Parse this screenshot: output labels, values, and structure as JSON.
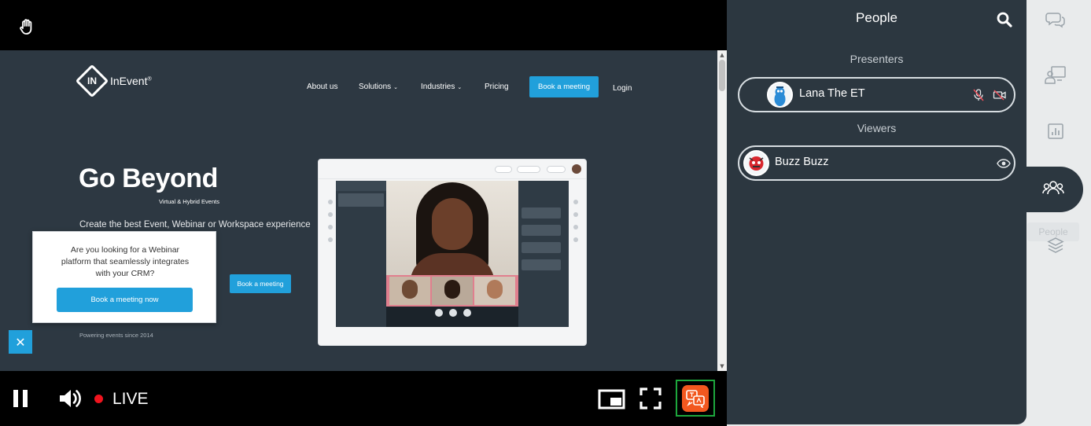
{
  "stream": {
    "site": {
      "logo_text": "InEvent",
      "logo_mark": "IN",
      "nav": [
        "About us",
        "Solutions",
        "Industries",
        "Pricing"
      ],
      "nav_book": "Book a meeting",
      "nav_login": "Login",
      "hero_title": "Go Beyond",
      "hero_subtitle": "Virtual & Hybrid Events",
      "hero_desc": "Create the best Event, Webinar or Workspace experience",
      "hero_book": "Book a meeting",
      "powered_since": "Powering events since 2014",
      "popup": {
        "text": "Are you looking for a Webinar\nplatform that seamlessly integrates\nwith your CRM?",
        "button": "Book a meeting now",
        "close": "✕"
      }
    }
  },
  "controls": {
    "live_label": "LIVE",
    "live_color": "#f0141e",
    "translate_color": "#f2581f",
    "translate_border": "#1da73d"
  },
  "people_panel": {
    "title": "People",
    "presenters_heading": "Presenters",
    "viewers_heading": "Viewers",
    "presenters": [
      {
        "name": "Lana The ET",
        "icons": [
          "mic-muted-icon",
          "camera-off-icon"
        ]
      }
    ],
    "viewers": [
      {
        "name": "Buzz Buzz",
        "icons": [
          "eye-icon"
        ]
      }
    ]
  },
  "rail": {
    "items": [
      "chat-icon",
      "presentation-icon",
      "poll-chart-icon",
      "people-icon",
      "layers-icon"
    ],
    "active": "people-icon",
    "tooltip": "People"
  }
}
